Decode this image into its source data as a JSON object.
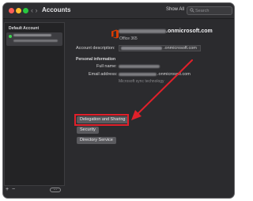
{
  "window": {
    "title": "Accounts"
  },
  "toolbar": {
    "show_all": "Show All",
    "search_placeholder": "Search"
  },
  "sidebar": {
    "section_label": "Default Account"
  },
  "account": {
    "email_domain": ".onmicrosoft.com",
    "type": "Office 365",
    "description_label": "Account description:",
    "description_domain": ".onmicrosoft.com",
    "section_title": "Personal information",
    "full_name_label": "Full name:",
    "email_label": "Email address:",
    "email_domain_value": ".onmicrosoft.com",
    "sync_note": "Microsoft sync technology"
  },
  "buttons": {
    "delegation": "Delegation and Sharing",
    "security": "Security",
    "directory": "Directory Service"
  },
  "footer": {
    "add": "+",
    "remove": "−",
    "more": "⋯"
  },
  "colors": {
    "highlight": "#e0202a",
    "office_logo": "#d83b01",
    "status_online": "#3dd44f"
  }
}
